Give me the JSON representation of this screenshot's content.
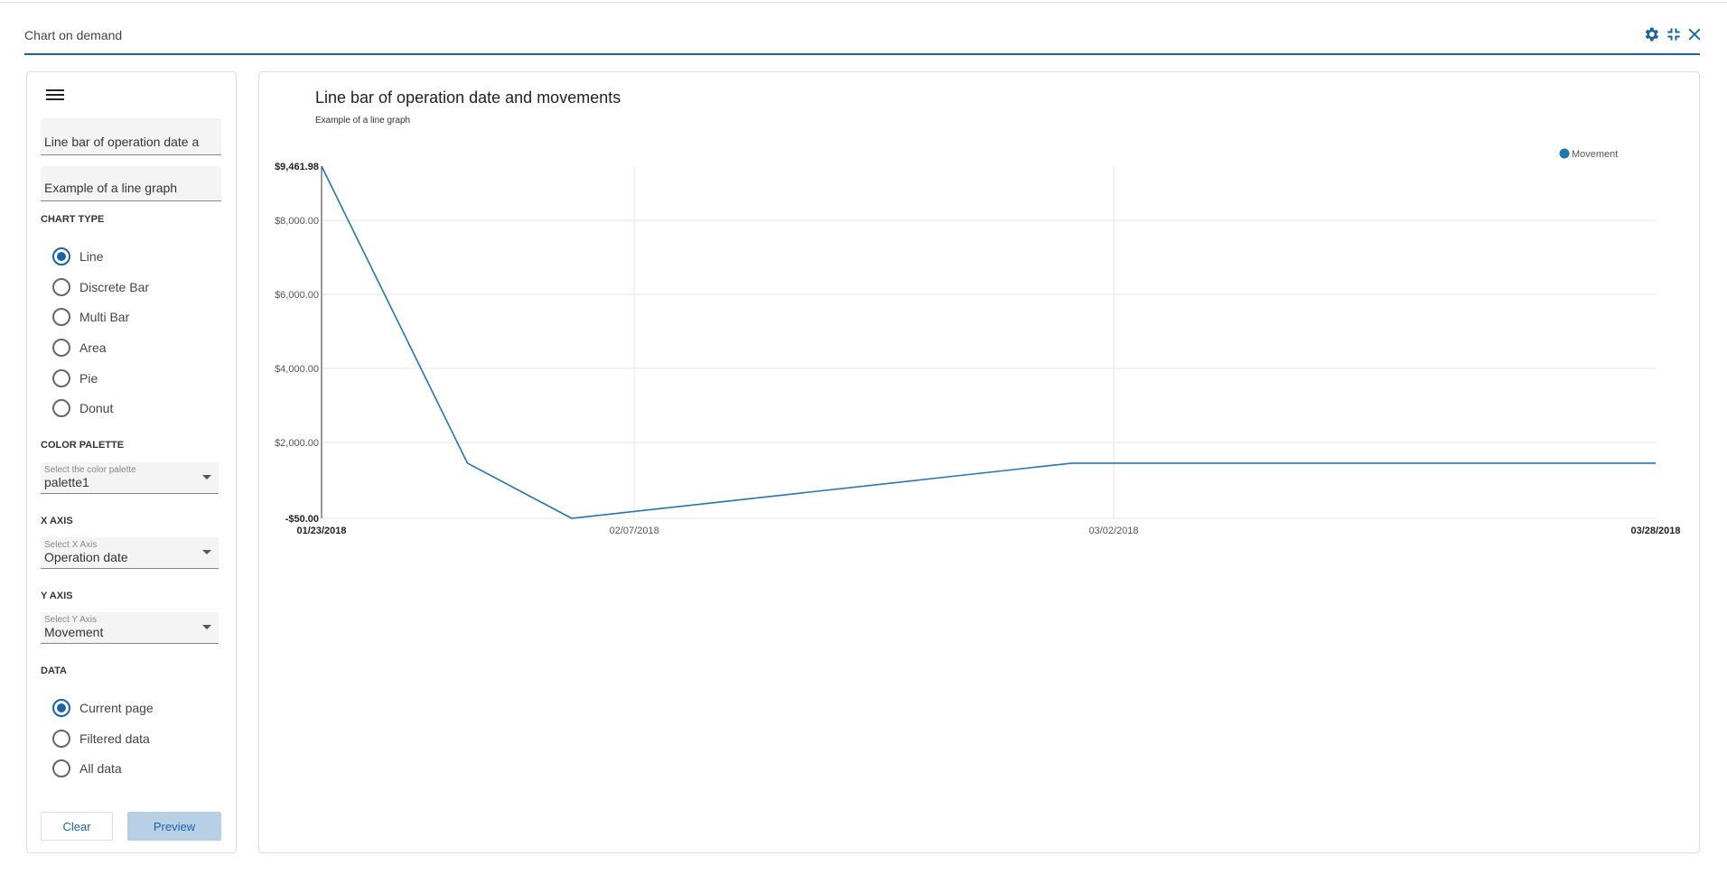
{
  "header": {
    "title": "Chart on demand",
    "icons": [
      "gear-icon",
      "collapse-icon",
      "close-icon"
    ],
    "accent": "#1a63a8"
  },
  "sidebar": {
    "menu_icon": "hamburger-icon",
    "title_input": "Line bar of operation date a",
    "subtitle_input": "Example of a line graph",
    "chart_type_label": "CHART TYPE",
    "chart_types": [
      {
        "label": "Line",
        "selected": true
      },
      {
        "label": "Discrete Bar",
        "selected": false
      },
      {
        "label": "Multi Bar",
        "selected": false
      },
      {
        "label": "Area",
        "selected": false
      },
      {
        "label": "Pie",
        "selected": false
      },
      {
        "label": "Donut",
        "selected": false
      }
    ],
    "color_palette_label": "COLOR PALETTE",
    "color_palette": {
      "placeholder": "Select the color palette",
      "value": "palette1"
    },
    "x_axis_label": "X AXIS",
    "x_axis": {
      "placeholder": "Select X Axis",
      "value": "Operation date"
    },
    "y_axis_label": "Y AXIS",
    "y_axis": {
      "placeholder": "Select Y Axis",
      "value": "Movement"
    },
    "data_label": "DATA",
    "data_options": [
      {
        "label": "Current page",
        "selected": true
      },
      {
        "label": "Filtered data",
        "selected": false
      },
      {
        "label": "All data",
        "selected": false
      }
    ],
    "clear_label": "Clear",
    "preview_label": "Preview"
  },
  "chart_data": {
    "type": "line",
    "title": "Line bar of operation date and movements",
    "subtitle": "Example of a line graph",
    "legend_position": "top-right",
    "grid": true,
    "series": [
      {
        "name": "Movement",
        "color": "#1f77b4",
        "x": [
          "01/23/2018",
          "01/30/2018",
          "02/04/2018",
          "02/28/2018",
          "03/28/2018"
        ],
        "values": [
          9461.98,
          1440,
          -50,
          1440,
          1440
        ]
      }
    ],
    "x_ticks": [
      "01/23/2018",
      "02/07/2018",
      "03/02/2018",
      "03/28/2018"
    ],
    "y_ticks": [
      "$9,461.98",
      "$8,000.00",
      "$6,000.00",
      "$4,000.00",
      "$2,000.00",
      "-$50.00"
    ],
    "y_tick_values": [
      9461.98,
      8000,
      6000,
      4000,
      2000,
      -50
    ],
    "xlim": [
      "01/23/2018",
      "03/28/2018"
    ],
    "ylim": [
      -50,
      9461.98
    ]
  }
}
